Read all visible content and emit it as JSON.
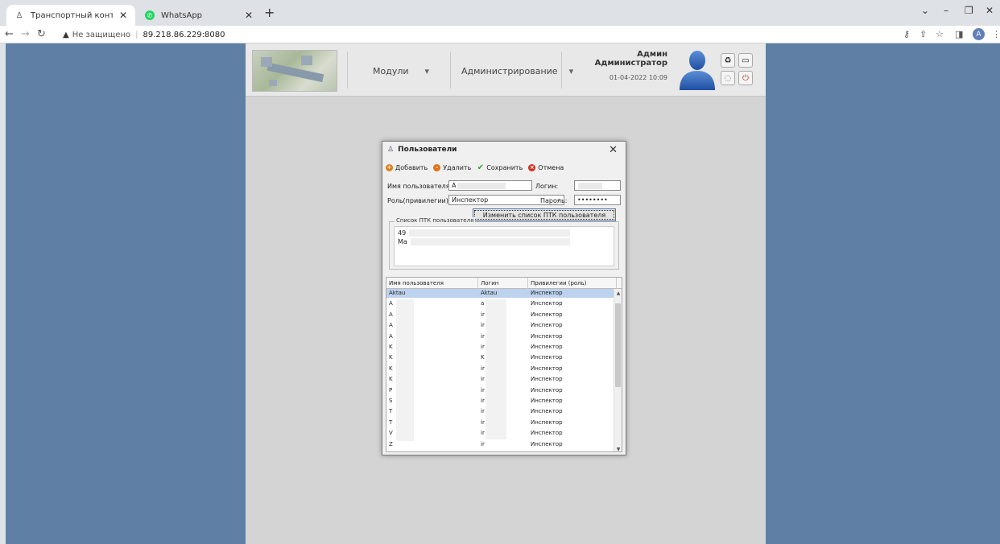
{
  "browser": {
    "tabs": [
      {
        "title": "Транспортный контроль",
        "active": true
      },
      {
        "title": "WhatsApp",
        "active": false
      }
    ],
    "security_label": "Не защищено",
    "url": "89.218.86.229:8080",
    "profile_initial": "A"
  },
  "header": {
    "menus": [
      "Модули",
      "Администрирование"
    ],
    "user_name": "Админ",
    "user_role": "Администратор",
    "datetime": "01-04-2022 10:09"
  },
  "dialog": {
    "title": "Пользователи",
    "toolbar": {
      "add": "Добавить",
      "delete": "Удалить",
      "save": "Сохранить",
      "cancel": "Отмена"
    },
    "form": {
      "username_label": "Имя пользователя:",
      "username_value": "А",
      "login_label": "Логин:",
      "login_value": "",
      "role_label": "Роль(привилегии):",
      "role_value": "Инспектор",
      "password_label": "Пароль:",
      "password_value": "••••••••",
      "change_ptk_button": "Изменить список ПТК пользователя"
    },
    "ptk_group_title": "Список ПТК пользователя",
    "ptk_items": [
      "49",
      "Ма"
    ],
    "grid": {
      "columns": [
        "Имя пользователя",
        "Логин",
        "Привилегии (роль)"
      ],
      "rows": [
        {
          "name": "Aktau",
          "login": "Aktau",
          "role": "Инспектор",
          "selected": true
        },
        {
          "name": "A",
          "login": "a",
          "role": "Инспектор"
        },
        {
          "name": "A",
          "login": "ir",
          "role": "Инспектор"
        },
        {
          "name": "A",
          "login": "ir",
          "role": "Инспектор"
        },
        {
          "name": "A",
          "login": "ir",
          "role": "Инспектор"
        },
        {
          "name": "K",
          "login": "ir",
          "role": "Инспектор"
        },
        {
          "name": "K",
          "login": "K",
          "role": "Инспектор"
        },
        {
          "name": "K",
          "login": "ir",
          "role": "Инспектор"
        },
        {
          "name": "K",
          "login": "ir",
          "role": "Инспектор"
        },
        {
          "name": "P",
          "login": "ir",
          "role": "Инспектор"
        },
        {
          "name": "S",
          "login": "ir",
          "role": "Инспектор"
        },
        {
          "name": "T",
          "login": "ir",
          "role": "Инспектор"
        },
        {
          "name": "T",
          "login": "ir",
          "role": "Инспектор"
        },
        {
          "name": "V",
          "login": "ir",
          "role": "Инспектор"
        },
        {
          "name": "Z",
          "login": "ir",
          "role": "Инспектор"
        }
      ]
    }
  },
  "colors": {
    "page_bg": "#5f80a4",
    "app_bg": "#d4d4d4",
    "selection": "#bcd2ee"
  }
}
